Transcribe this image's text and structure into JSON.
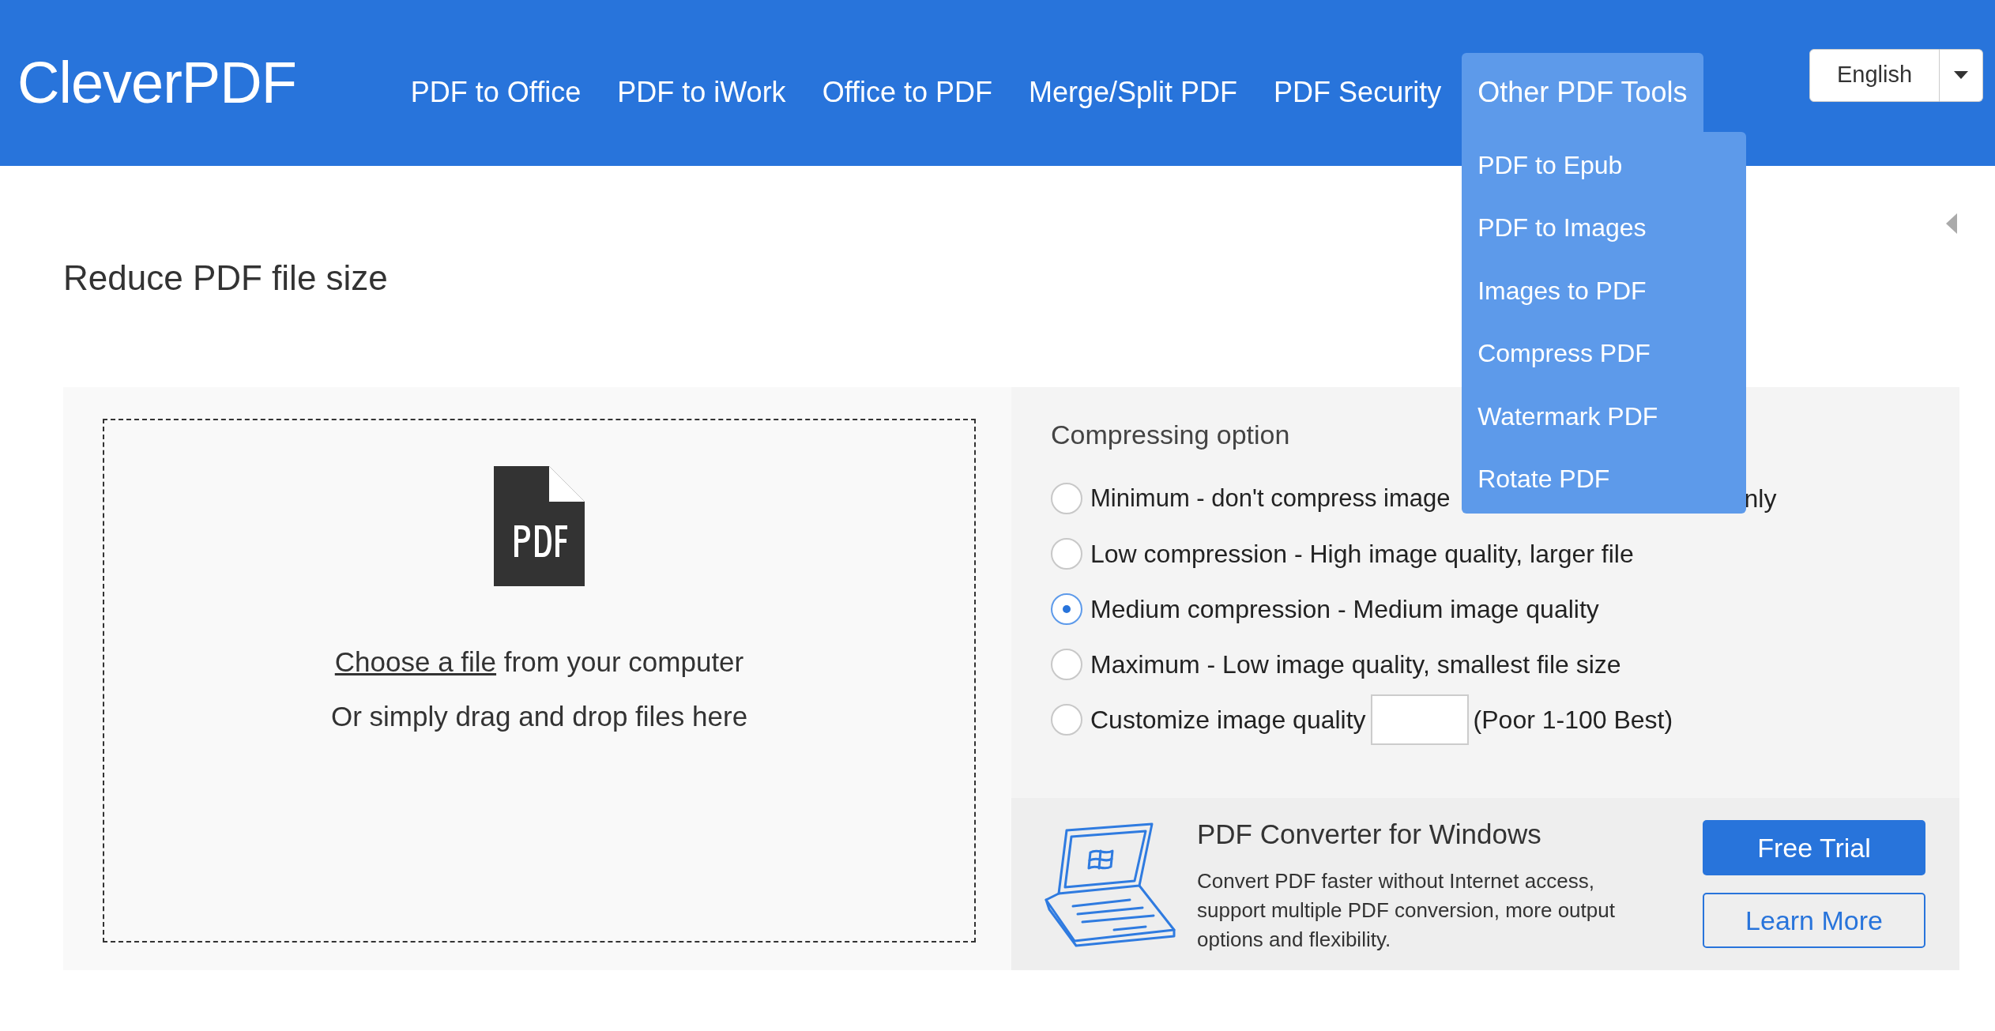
{
  "logo": "CleverPDF",
  "nav": [
    {
      "label": "PDF to Office",
      "selected": false
    },
    {
      "label": "PDF to iWork",
      "selected": false
    },
    {
      "label": "Office to PDF",
      "selected": false
    },
    {
      "label": "Merge/Split PDF",
      "selected": false
    },
    {
      "label": "PDF Security",
      "selected": false
    },
    {
      "label": "Other PDF Tools",
      "selected": true,
      "children": [
        "PDF to Epub",
        "PDF to Images",
        "Images to PDF",
        "Compress PDF",
        "Watermark PDF",
        "Rotate PDF"
      ]
    }
  ],
  "language": {
    "value": "English"
  },
  "page_title": "Reduce PDF file size",
  "upload": {
    "link": "Choose a file",
    "text": "from your computer",
    "hint": "Or simply drag and drop files here"
  },
  "options": {
    "title": "Compressing option",
    "items": [
      {
        "kind": "split",
        "label": "Minimum - don't compress image",
        "label_tail": "nly",
        "selected": false
      },
      {
        "kind": "plain",
        "label": "Low compression - High image quality, larger file",
        "selected": false
      },
      {
        "kind": "plain",
        "label": "Medium compression - Medium image quality",
        "selected": true
      },
      {
        "kind": "plain",
        "label": "Maximum - Low image quality, smallest file size",
        "selected": false
      },
      {
        "kind": "custom",
        "label": "Customize image quality",
        "hint": "(Poor 1-100 Best)",
        "selected": false
      }
    ]
  },
  "promo": {
    "title": "PDF Converter for Windows",
    "text": "Convert PDF faster without Internet access, support multiple PDF conversion, more output options and flexibility.",
    "buttons": [
      {
        "kind": "primary",
        "label": "Free Trial"
      },
      {
        "kind": "outline",
        "label": "Learn More"
      }
    ]
  }
}
